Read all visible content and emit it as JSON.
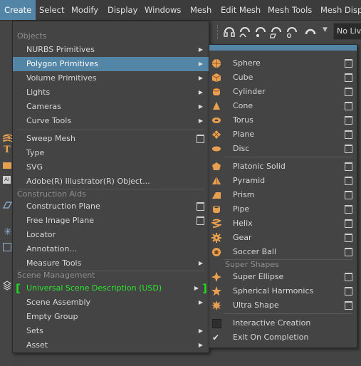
{
  "menubar": {
    "items": [
      "Create",
      "Select",
      "Modify",
      "Display",
      "Windows",
      "Mesh",
      "Edit Mesh",
      "Mesh Tools",
      "Mesh Displ"
    ]
  },
  "toolbar": {
    "dropdown_value": "No Live"
  },
  "create_menu": {
    "sections": {
      "objects": "Objects",
      "construction_aids": "Construction Aids",
      "scene_management": "Scene Management"
    },
    "items": [
      {
        "label": "NURBS Primitives",
        "submenu": true
      },
      {
        "label": "Polygon Primitives",
        "submenu": true,
        "highlighted": true
      },
      {
        "label": "Volume Primitives",
        "submenu": true
      },
      {
        "label": "Lights",
        "submenu": true
      },
      {
        "label": "Cameras",
        "submenu": true
      },
      {
        "label": "Curve Tools",
        "submenu": true
      },
      {
        "label": "Sweep Mesh",
        "option_box": true
      },
      {
        "label": "Type"
      },
      {
        "label": "SVG"
      },
      {
        "label": "Adobe(R) Illustrator(R) Object..."
      },
      {
        "label": "Construction Plane",
        "option_box": true
      },
      {
        "label": "Free Image Plane",
        "option_box": true
      },
      {
        "label": "Locator"
      },
      {
        "label": "Annotation..."
      },
      {
        "label": "Measure Tools",
        "submenu": true
      },
      {
        "label": "Universal Scene Description (USD)",
        "submenu": true,
        "color": "#2ee62e"
      },
      {
        "label": "Scene Assembly",
        "submenu": true
      },
      {
        "label": "Empty Group"
      },
      {
        "label": "Sets",
        "submenu": true
      },
      {
        "label": "Asset",
        "submenu": true
      }
    ]
  },
  "polygon_submenu": {
    "section_super_shapes": "Super Shapes",
    "items": [
      {
        "label": "Sphere"
      },
      {
        "label": "Cube"
      },
      {
        "label": "Cylinder"
      },
      {
        "label": "Cone"
      },
      {
        "label": "Torus"
      },
      {
        "label": "Plane"
      },
      {
        "label": "Disc"
      },
      {
        "label": "Platonic Solid"
      },
      {
        "label": "Pyramid"
      },
      {
        "label": "Prism"
      },
      {
        "label": "Pipe"
      },
      {
        "label": "Helix"
      },
      {
        "label": "Gear"
      },
      {
        "label": "Soccer Ball"
      },
      {
        "label": "Super Ellipse"
      },
      {
        "label": "Spherical Harmonics"
      },
      {
        "label": "Ultra Shape"
      },
      {
        "label": "Interactive Creation",
        "checked": false
      },
      {
        "label": "Exit On Completion",
        "checked": true
      }
    ]
  },
  "colors": {
    "highlight": "#5285a6",
    "icon_orange": "#e8a050",
    "usd_green": "#2ee62e"
  }
}
